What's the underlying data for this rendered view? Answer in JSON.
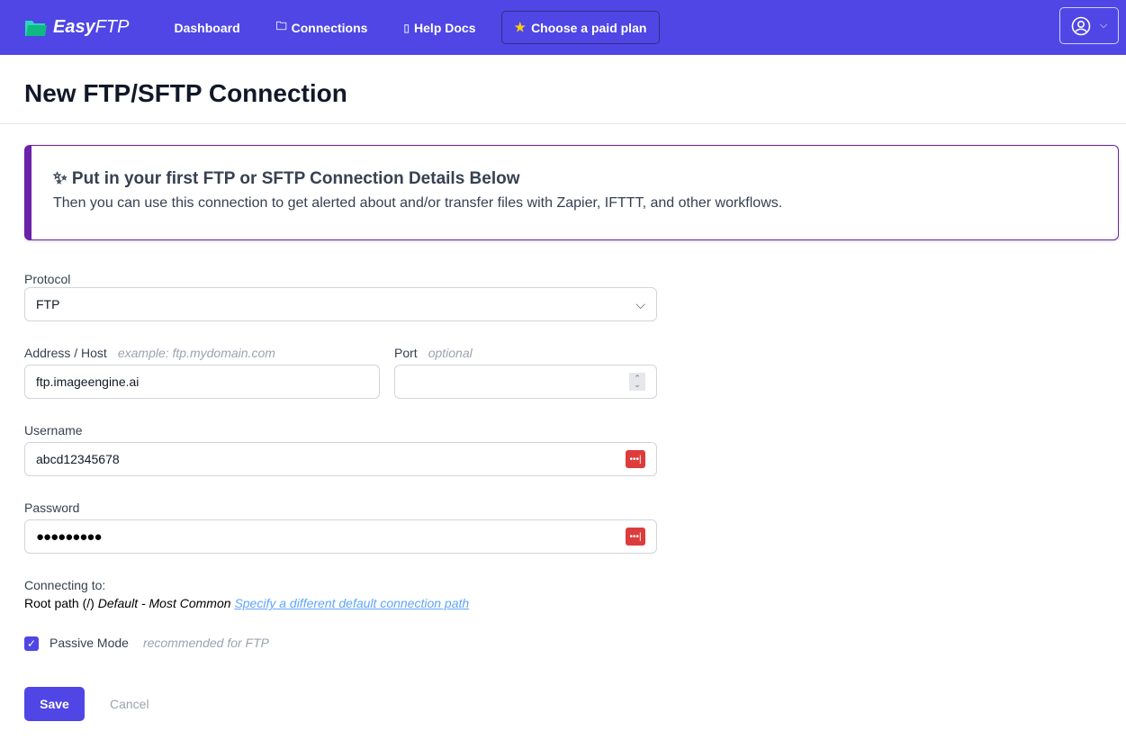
{
  "nav": {
    "brand_bold": "Easy",
    "brand_light": "FTP",
    "links": [
      "Dashboard",
      "Connections",
      "Help Docs"
    ],
    "plan": "Choose a paid plan"
  },
  "page_title": "New FTP/SFTP Connection",
  "banner": {
    "title": "Put in your first FTP or SFTP Connection Details Below",
    "text": "Then you can use this connection to get alerted about and/or transfer files with Zapier, IFTTT, and other workflows."
  },
  "form": {
    "protocol_label": "Protocol",
    "protocol_value": "FTP",
    "host_label": "Address / Host",
    "host_hint": "example: ftp.mydomain.com",
    "host_value": "ftp.imageengine.ai",
    "port_label": "Port",
    "port_hint": "optional",
    "port_value": "",
    "username_label": "Username",
    "username_value": "abcd12345678",
    "password_label": "Password",
    "password_value": "●●●●●●●●●",
    "connecting_label": "Connecting to:",
    "root_path": "Root path (/)",
    "default_text": "Default - Most Common",
    "path_link": "Specify a different default connection path",
    "passive_label": "Passive Mode",
    "passive_hint": "recommended for FTP",
    "passive_checked": true,
    "save": "Save",
    "cancel": "Cancel"
  },
  "colors": {
    "accent": "#4f46e5",
    "banner_border": "#6b21a8",
    "password_manager": "#dc3c3c"
  }
}
